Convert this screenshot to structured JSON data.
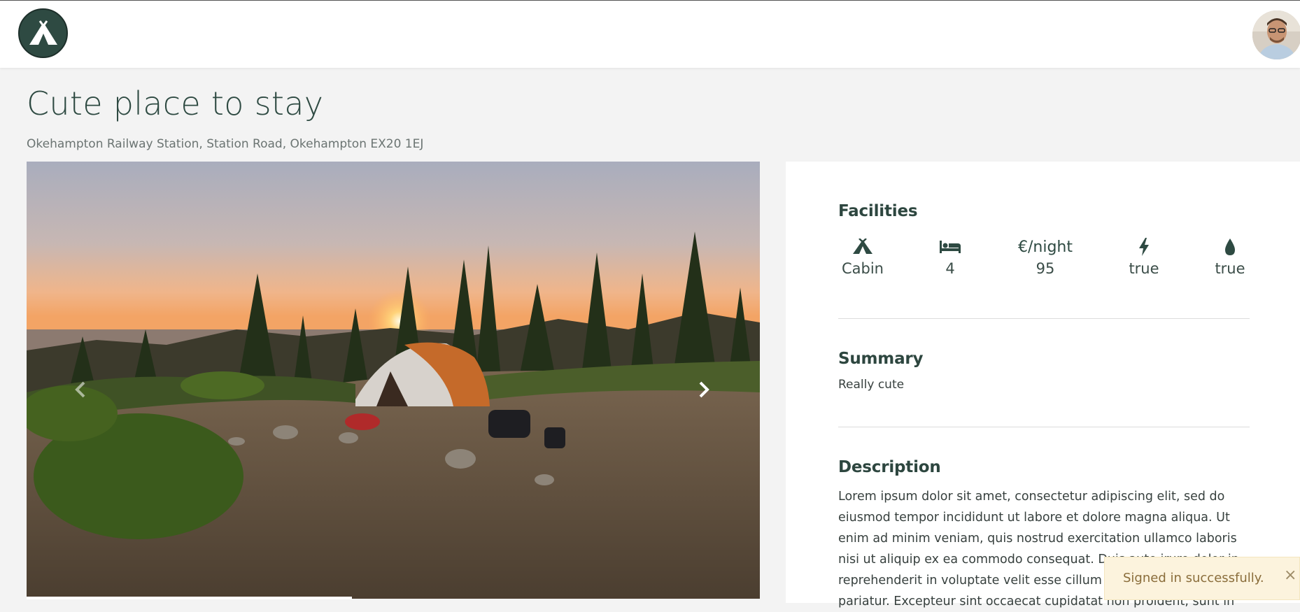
{
  "header": {
    "logo_icon": "tent-icon",
    "avatar_icon": "user-avatar"
  },
  "listing": {
    "title": "Cute place to stay",
    "address": "Okehampton Railway Station, Station Road, Okehampton EX20 1EJ"
  },
  "carousel": {
    "image_icon": "tent-at-sunset-photo",
    "prev_icon": "chevron-left-icon",
    "next_icon": "chevron-right-icon"
  },
  "facilities": {
    "heading": "Facilities",
    "items": [
      {
        "icon": "tent-icon",
        "label": "",
        "value": "Cabin"
      },
      {
        "icon": "bed-icon",
        "label": "",
        "value": "4"
      },
      {
        "icon": "euro-icon",
        "label": "€/night",
        "value": "95"
      },
      {
        "icon": "lightning-icon",
        "label": "",
        "value": "true"
      },
      {
        "icon": "water-drop-icon",
        "label": "",
        "value": "true"
      }
    ]
  },
  "summary": {
    "heading": "Summary",
    "text": "Really cute"
  },
  "description": {
    "heading": "Description",
    "text": "Lorem ipsum dolor sit amet, consectetur adipiscing elit, sed do eiusmod tempor incididunt ut labore et dolore magna aliqua. Ut enim ad minim veniam, quis nostrud exercitation ullamco laboris nisi ut aliquip ex ea commodo consequat. Duis aute irure dolor in reprehenderit in voluptate velit esse cillum dolore eu fugiat nulla pariatur. Excepteur sint occaecat cupidatat non proident, sunt in"
  },
  "toast": {
    "text": "Signed in successfully.",
    "close": "×"
  },
  "colors": {
    "brand": "#2e4a42",
    "page_bg": "#f3f3f3",
    "toast_bg": "#fcf3dd",
    "toast_text": "#8a6d3b"
  }
}
